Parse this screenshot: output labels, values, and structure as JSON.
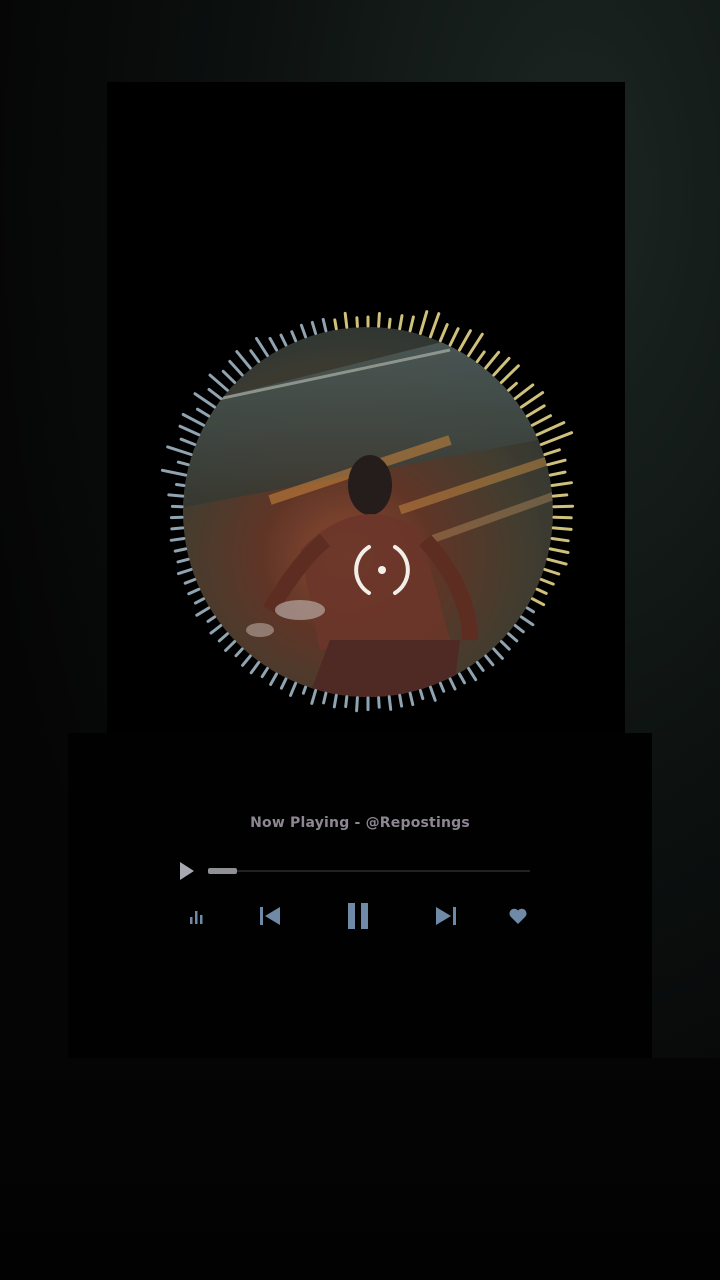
{
  "player": {
    "now_playing": "Now Playing - @Repostings",
    "progress": 0.09,
    "state": "playing"
  },
  "controls": {
    "equalizer_icon": "equalizer-icon",
    "previous_icon": "skip-previous-icon",
    "pause_icon": "pause-icon",
    "next_icon": "skip-next-icon",
    "like_icon": "heart-icon"
  },
  "colors": {
    "background": "#000000",
    "title": "#8f8694",
    "controls": "#6f8aa6",
    "progress_fill": "#8e9096",
    "visualizer_warm": "#e6d58a",
    "visualizer_cool": "#9fb6c4"
  }
}
